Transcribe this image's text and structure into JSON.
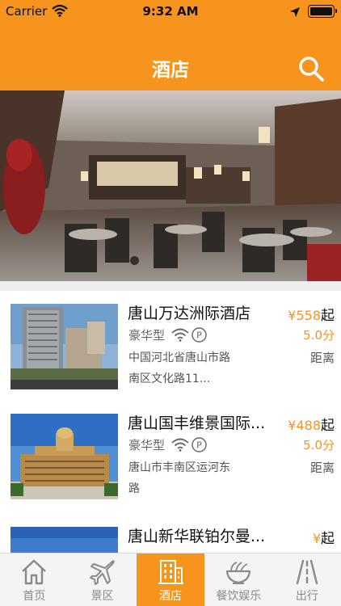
{
  "status_bar": {
    "carrier": "Carrier",
    "time": "9:32 AM"
  },
  "nav": {
    "title": "酒店",
    "search_icon": "search-icon"
  },
  "banner": {
    "image": "restaurant-interior-photo",
    "slide_indicator": "carousel-dot"
  },
  "hotels": [
    {
      "name": "唐山万达洲际酒店",
      "price": "¥558",
      "price_suffix": "起",
      "level": "豪华型",
      "amenities": [
        "wifi-icon",
        "parking-icon"
      ],
      "score": "5.0分",
      "address": "中国河北省唐山市路南区文化路11...",
      "distance": "距离",
      "thumb": "hotel-tower-photo"
    },
    {
      "name": "唐山国丰维景国际...",
      "price": "¥488",
      "price_suffix": "起",
      "level": "豪华型",
      "amenities": [
        "wifi-icon",
        "parking-icon"
      ],
      "score": "5.0分",
      "address": "唐山市丰南区运河东路",
      "distance": "距离",
      "thumb": "hotel-dome-photo"
    },
    {
      "name": "唐山新华联铂尔曼...",
      "price": "¥",
      "price_suffix": "起",
      "thumb": "hotel-sky-photo"
    }
  ],
  "tabs": [
    {
      "label": "首页",
      "icon": "home-icon",
      "active": false
    },
    {
      "label": "景区",
      "icon": "airplane-icon",
      "active": false
    },
    {
      "label": "酒店",
      "icon": "building-icon",
      "active": true
    },
    {
      "label": "餐饮娱乐",
      "icon": "noodle-bowl-icon",
      "active": false
    },
    {
      "label": "出行",
      "icon": "road-icon",
      "active": false
    }
  ],
  "colors": {
    "brand": "#f7941d",
    "text": "#111111",
    "muted": "#8a8a8a"
  }
}
